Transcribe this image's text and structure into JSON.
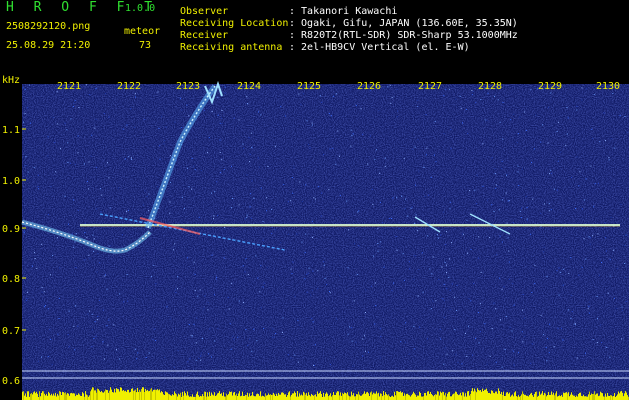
{
  "app": {
    "logo": "H R O F F T",
    "version": "1.0.0"
  },
  "image": {
    "filename": "2508292120.png",
    "datetime": "25.08.29 21:20"
  },
  "meteor": {
    "label": "meteor",
    "count": "73"
  },
  "info": [
    {
      "key": "Observer",
      "value": ": Takanori Kawachi"
    },
    {
      "key": "Receiving Location",
      "value": ": Ogaki, Gifu, JAPAN (136.60E, 35.35N)"
    },
    {
      "key": "Receiver",
      "value": ": R820T2(RTL-SDR) SDR-Sharp 53.1000MHz"
    },
    {
      "key": "Receiving antenna",
      "value": ": 2el-HB9CV Vertical (el. E-W)"
    }
  ],
  "axes": {
    "y_unit": "kHz",
    "y_ticks": [
      "1.1",
      "1.0",
      "0.9",
      "0.8",
      "0.7",
      "0.6"
    ],
    "x_ticks": [
      "2121",
      "2122",
      "2123",
      "2124",
      "2125",
      "2126",
      "2127",
      "2128",
      "2129",
      "2130"
    ]
  },
  "colors": {
    "label_yellow": "#f0f000",
    "title_green": "#30e030",
    "background": "#000000",
    "plot_bg": "#101a6a",
    "carrier": "#e0ffd0"
  }
}
